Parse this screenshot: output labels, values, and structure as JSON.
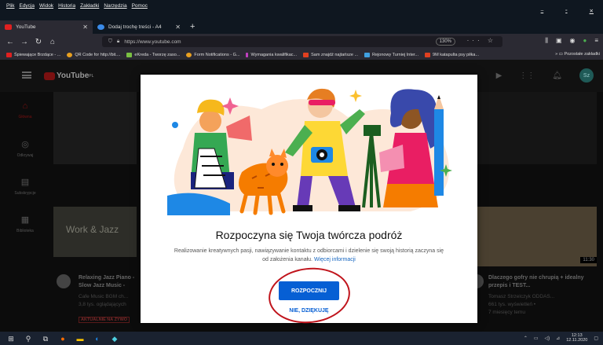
{
  "menu": [
    "Plik",
    "Edycja",
    "Widok",
    "Historia",
    "Zakładki",
    "Narzędzia",
    "Pomoc"
  ],
  "tabs": [
    {
      "label": "YouTube",
      "favicon_color": "#e02020"
    },
    {
      "label": "Dodaj trochę treści - A4",
      "favicon_color": "#3a8be8"
    }
  ],
  "url": "https://www.youtube.com",
  "zoom": "130%",
  "bookmarks": [
    {
      "label": "Śpiewające Brzdące - ...",
      "color": "#e02020"
    },
    {
      "label": "QR Code for http://bit....",
      "color": "#e8a020"
    },
    {
      "label": "eKreda - Tworzę zaso...",
      "color": "#7ac043"
    },
    {
      "label": "Form Notifications - G...",
      "color": "#e8a020"
    },
    {
      "label": "Wymagania kwalifikac...",
      "color": "#c040c0"
    },
    {
      "label": "Sam znajdź najtańsze ...",
      "color": "#e04020"
    },
    {
      "label": "Rejonowy Turniej Inter...",
      "color": "#40a0e0"
    },
    {
      "label": "9M katapulta psy piłka...",
      "color": "#e04020"
    }
  ],
  "bookmarks_other": "Pozostałe zakładki",
  "youtube": {
    "logo": "YouTube",
    "logo_sup": "PL",
    "avatar": "Sz",
    "sidebar": [
      "Główna",
      "Odkrywaj",
      "Subskrypcje",
      "Biblioteka"
    ],
    "left_video": {
      "thumb_text": "Work & Jazz",
      "title": "Relaxing Jazz Piano - Slow Jazz Music -",
      "channel": "Cafe Music BGM ch...",
      "views": "3,8 tys. oglądających",
      "badge": "AKTUALNIE NA ŻYWO"
    },
    "right_video": {
      "duration": "11:30",
      "title": "Dlaczego gofry nie chrupią + idealny przepis i TEST...",
      "channel": "Tomasz Strzelczyk ODDAS...",
      "views": "661 tys. wyświetleń •",
      "age": "7 miesięcy temu"
    }
  },
  "modal": {
    "title": "Rozpoczyna się Twoja twórcza podróż",
    "desc": "Realizowanie kreatywnych pasji, nawiązywanie kontaktu z odbiorcami i dzielenie się swoją historią zaczyna się od założenia kanału.",
    "link": "Więcej informacji",
    "primary": "ROZPOCZNIJ",
    "secondary": "NIE, DZIĘKUJĘ"
  },
  "taskbar": {
    "time": "12:13",
    "date": "12.11.2020"
  }
}
